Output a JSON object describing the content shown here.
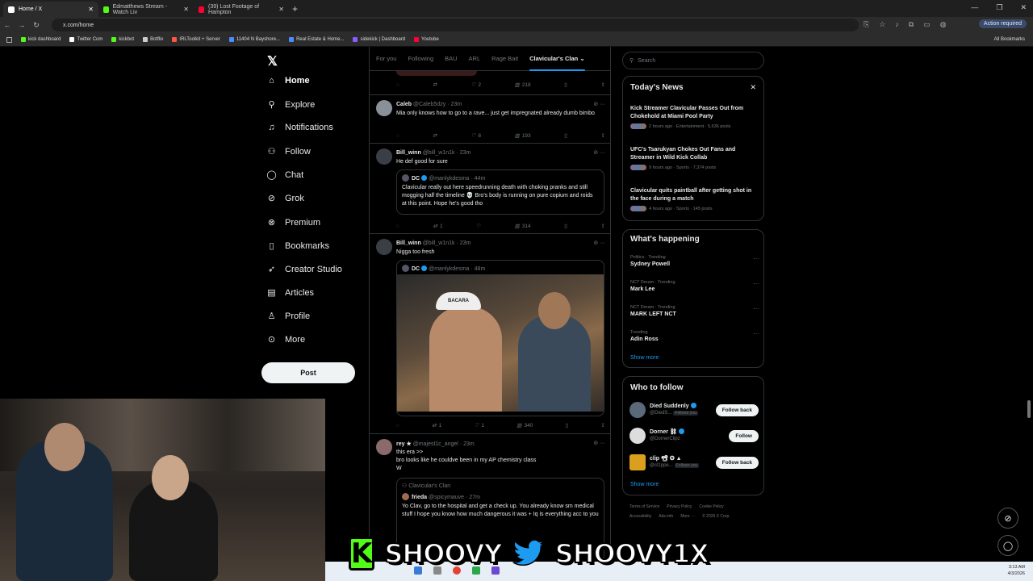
{
  "browser": {
    "tabs": [
      {
        "label": "Home / X",
        "color": "#ffffff",
        "active": true
      },
      {
        "label": "Edmatthews Stream - Watch Liv",
        "color": "#53fc18",
        "active": false
      },
      {
        "label": "(39) Lost Footage of Hampton",
        "color": "#ff0033",
        "active": false
      }
    ],
    "url": "x.com/home",
    "action_required": "Action required",
    "bookmarks": [
      {
        "label": "kick dashboard",
        "color": "#53fc18"
      },
      {
        "label": "Twitter Com",
        "color": "#ffffff"
      },
      {
        "label": "kickbot",
        "color": "#53fc18"
      },
      {
        "label": "Botflix",
        "color": "#cccccc"
      },
      {
        "label": "IRLToolkit + Server",
        "color": "#ff5544"
      },
      {
        "label": "11404 N Bayshore...",
        "color": "#4a8cff"
      },
      {
        "label": "Real Estate & Home...",
        "color": "#4a8cff"
      },
      {
        "label": "sidekick | Dashboard",
        "color": "#8a5cff"
      },
      {
        "label": "Youtube",
        "color": "#ff0033"
      }
    ],
    "all_bookmarks": "All Bookmarks"
  },
  "nav": {
    "items": [
      {
        "label": "Home",
        "icon": "home-icon",
        "glyph": "⌂"
      },
      {
        "label": "Explore",
        "icon": "search-icon",
        "glyph": "⚲"
      },
      {
        "label": "Notifications",
        "icon": "bell-icon",
        "glyph": "♫"
      },
      {
        "label": "Follow",
        "icon": "person-add-icon",
        "glyph": "⚇"
      },
      {
        "label": "Chat",
        "icon": "chat-icon",
        "glyph": "◯"
      },
      {
        "label": "Grok",
        "icon": "grok-icon",
        "glyph": "⊘"
      },
      {
        "label": "Premium",
        "icon": "premium-icon",
        "glyph": "⊗"
      },
      {
        "label": "Bookmarks",
        "icon": "bookmark-icon",
        "glyph": "▯"
      },
      {
        "label": "Creator Studio",
        "icon": "rocket-icon",
        "glyph": "➶"
      },
      {
        "label": "Articles",
        "icon": "articles-icon",
        "glyph": "▤"
      },
      {
        "label": "Profile",
        "icon": "profile-icon",
        "glyph": "♙"
      },
      {
        "label": "More",
        "icon": "more-icon",
        "glyph": "⊙"
      }
    ],
    "post_label": "Post"
  },
  "feed": {
    "tabs": [
      "For you",
      "Following",
      "BAU",
      "ARL",
      "Rage Bait",
      "Clavicular's Clan"
    ],
    "top_actions": {
      "likes": "2",
      "views": "218"
    },
    "tweets": [
      {
        "name": "Caleb",
        "handle": "@Caleb5dzy",
        "time": "23m",
        "text": "Mia only knows how to go to a rave... just get impregnated already dumb bimbo",
        "likes": "8",
        "views": "193"
      },
      {
        "name": "Bill_winn",
        "handle": "@bill_w1n1k",
        "time": "23m",
        "text": "He def good for sure",
        "quote": {
          "name": "DC",
          "handle": "@manlykdesma",
          "time": "44m",
          "text": "Clavicular really out here speedrunning death with choking pranks and still mogging half the timeline 💀 Bro's body is running on pure copium and roids at this point. Hope he's good tho"
        },
        "reposts": "1",
        "views": "314"
      },
      {
        "name": "Bill_winn",
        "handle": "@bill_w1n1k",
        "time": "23m",
        "text": "Nigga too fresh",
        "quote": {
          "name": "DC",
          "handle": "@manlykdesma",
          "time": "48m",
          "photo_cap": "BACARA"
        },
        "reposts": "1",
        "likes": "1",
        "views": "340"
      },
      {
        "name": "rey ★",
        "handle": "@majest1c_angel",
        "time": "23m",
        "text": "this era >>",
        "text2": "bro looks like he couldve been in my AP chemistry class",
        "text3": "W",
        "quote": {
          "community": "Clavicular's Clan",
          "name": "frieda",
          "handle": "@spicymauve",
          "time": "27m",
          "text": "Yo Clav, go to the hospital and get a check up. You already know sm medical stuff I hope you know how much dangerous it was + Iq is everything acc to you"
        }
      }
    ]
  },
  "sidebar": {
    "search_placeholder": "Search",
    "news_title": "Today's News",
    "news": [
      {
        "title": "Kick Streamer Clavicular Passes Out from Chokehold at Miami Pool Party",
        "meta": "2 hours ago · Entertainment · 5,636 posts"
      },
      {
        "title": "UFC's Tsarukyan Chokes Out Fans and Streamer in Wild Kick Collab",
        "meta": "9 hours ago · Sports · 7,374 posts"
      },
      {
        "title": "Clavicular quits paintball after getting shot in the face during a match",
        "meta": "4 hours ago · Sports · 145 posts"
      }
    ],
    "happening_title": "What's happening",
    "trends": [
      {
        "context": "Politics · Trending",
        "name": "Sydney Powell"
      },
      {
        "context": "NCT Dream · Trending",
        "name": "Mark Lee"
      },
      {
        "context": "NCT Dream · Trending",
        "name": "MARK LEFT NCT"
      },
      {
        "context": "Trending",
        "name": "Adin Ross"
      }
    ],
    "show_more": "Show more",
    "wtf_title": "Who to follow",
    "wtf": [
      {
        "name": "Died Suddenly",
        "handle": "@DiedS...",
        "follows_you": "Follows you",
        "button": "Follow back",
        "color": "#5a6a7a"
      },
      {
        "name": "Dorner ⛓",
        "handle": "@DornerClipz",
        "follows_you": "",
        "button": "Follow",
        "color": "#dddddd"
      },
      {
        "name": "clip 📽 ✪ ▲",
        "handle": "@cl1ppe...",
        "follows_you": "Follows you",
        "button": "Follow back",
        "color": "#d9a020"
      }
    ],
    "wtf_show_more": "Show more",
    "footer": [
      "Terms of Service",
      "Privacy Policy",
      "Cookie Policy",
      "Accessibility",
      "Ads info",
      "More ···",
      "© 2026 X Corp."
    ]
  },
  "overlay": {
    "kick_letter": "K",
    "kick_name": "SHOOVY",
    "twitter_name": "SHOOVY1X"
  },
  "taskbar": {
    "time": "3:13 AM",
    "date": "4/3/2026"
  }
}
